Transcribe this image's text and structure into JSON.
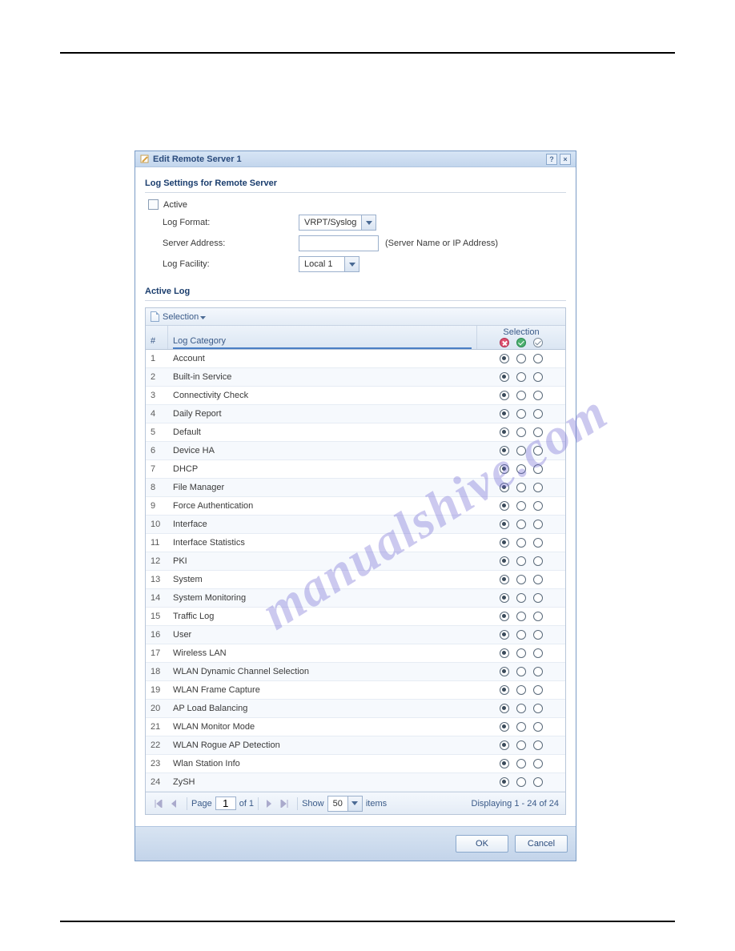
{
  "watermark": "manualshive.com",
  "dialog": {
    "title": "Edit Remote Server 1",
    "help": "?",
    "close": "×"
  },
  "settings": {
    "section_title": "Log Settings for Remote Server",
    "active_label": "Active",
    "log_format_label": "Log Format:",
    "log_format_value": "VRPT/Syslog",
    "server_address_label": "Server Address:",
    "server_address_value": "",
    "server_address_hint": "(Server Name or IP Address)",
    "log_facility_label": "Log Facility:",
    "log_facility_value": "Local 1"
  },
  "active_log": {
    "title": "Active Log",
    "selection_tool": "Selection",
    "col_num": "#",
    "col_category": "Log Category",
    "col_selection": "Selection",
    "rows": [
      {
        "n": "1",
        "cat": "Account"
      },
      {
        "n": "2",
        "cat": "Built-in Service"
      },
      {
        "n": "3",
        "cat": "Connectivity Check"
      },
      {
        "n": "4",
        "cat": "Daily Report"
      },
      {
        "n": "5",
        "cat": "Default"
      },
      {
        "n": "6",
        "cat": "Device HA"
      },
      {
        "n": "7",
        "cat": "DHCP"
      },
      {
        "n": "8",
        "cat": "File Manager"
      },
      {
        "n": "9",
        "cat": "Force Authentication"
      },
      {
        "n": "10",
        "cat": "Interface"
      },
      {
        "n": "11",
        "cat": "Interface Statistics"
      },
      {
        "n": "12",
        "cat": "PKI"
      },
      {
        "n": "13",
        "cat": "System"
      },
      {
        "n": "14",
        "cat": "System Monitoring"
      },
      {
        "n": "15",
        "cat": "Traffic Log"
      },
      {
        "n": "16",
        "cat": "User"
      },
      {
        "n": "17",
        "cat": "Wireless LAN"
      },
      {
        "n": "18",
        "cat": "WLAN Dynamic Channel Selection"
      },
      {
        "n": "19",
        "cat": "WLAN Frame Capture"
      },
      {
        "n": "20",
        "cat": "AP Load Balancing"
      },
      {
        "n": "21",
        "cat": "WLAN Monitor Mode"
      },
      {
        "n": "22",
        "cat": "WLAN Rogue AP Detection"
      },
      {
        "n": "23",
        "cat": "Wlan Station Info"
      },
      {
        "n": "24",
        "cat": "ZySH"
      }
    ]
  },
  "paging": {
    "page_label": "Page",
    "page_value": "1",
    "of_label": "of 1",
    "show_label": "Show",
    "show_value": "50",
    "items_label": "items",
    "display": "Displaying 1 - 24 of 24"
  },
  "buttons": {
    "ok": "OK",
    "cancel": "Cancel"
  }
}
